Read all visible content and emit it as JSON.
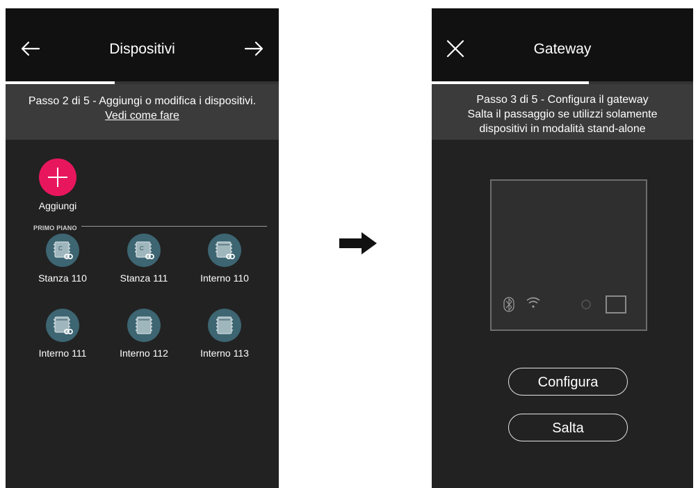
{
  "left_screen": {
    "title": "Dispositivi",
    "progress": 0.4,
    "step_text": "Passo 2 di 5 - Aggiungi o modifica i dispositivi.",
    "help_link": "Vedi come fare",
    "add_label": "Aggiungi",
    "section_label": "PRIMO PIANO",
    "devices": [
      {
        "label": "Stanza 110",
        "icon": "room-thermostat-link-icon"
      },
      {
        "label": "Stanza 111",
        "icon": "room-thermostat-link-icon"
      },
      {
        "label": "Interno 110",
        "icon": "internal-unit-link-icon"
      },
      {
        "label": "Interno 111",
        "icon": "internal-unit-link-icon"
      },
      {
        "label": "Interno 112",
        "icon": "internal-unit-icon"
      },
      {
        "label": "Interno 113",
        "icon": "internal-unit-icon"
      }
    ]
  },
  "right_screen": {
    "title": "Gateway",
    "progress": 0.6,
    "step_lines": [
      "Passo 3 di 5 - Configura il gateway",
      "Salta il passaggio se utilizzi solamente",
      "dispositivi in modalità stand-alone"
    ],
    "configure_label": "Configura",
    "skip_label": "Salta"
  },
  "colors": {
    "screen_bg": "#222222",
    "topbar_bg": "#111111",
    "band_bg": "#3b3b3b",
    "add_accent": "#e8175d",
    "device_icon_bg": "#3d6572"
  }
}
